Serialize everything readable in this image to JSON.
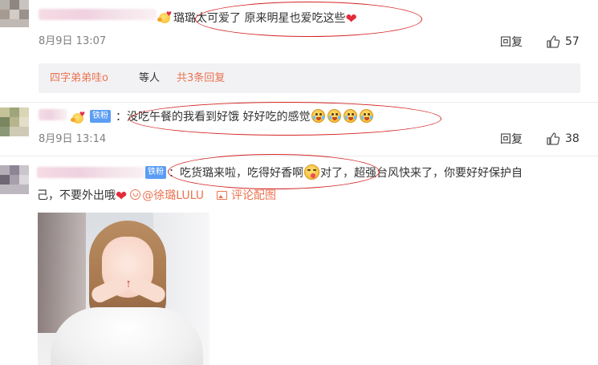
{
  "comments": [
    {
      "text": "璐璐太可爱了  原来明星也爱吃这些",
      "time": "8月9日 13:07",
      "reply_label": "回复",
      "likes": "57",
      "replies_preview": {
        "who": "四字弟弟哇o",
        "etc": "等人",
        "more": "共3条回复"
      }
    },
    {
      "prefix": "：",
      "fan_badge": "铁粉",
      "text": "没吃午餐的我看到好饿 好好吃的感觉",
      "time": "8月9日 13:14",
      "reply_label": "回复",
      "likes": "38"
    },
    {
      "fan_badge": "铁粉",
      "text_part1": "：吃货璐来啦，吃得好香啊",
      "text_part2": "对了，超强台风快来了，你要好好保护自",
      "text_line2": "己，不要外出哦",
      "mention": "@徐璐LULU",
      "pic_link": "评论配图"
    }
  ],
  "icons": [
    "thumb-up-icon",
    "heart-emoji-icon",
    "crying-emoji-icon",
    "yum-emoji-icon",
    "image-icon",
    "mention-icon"
  ],
  "colors": {
    "accent": "#eb7350",
    "fan_badge": "#5b9df5",
    "annotation": "#d32525",
    "time": "#808080"
  }
}
